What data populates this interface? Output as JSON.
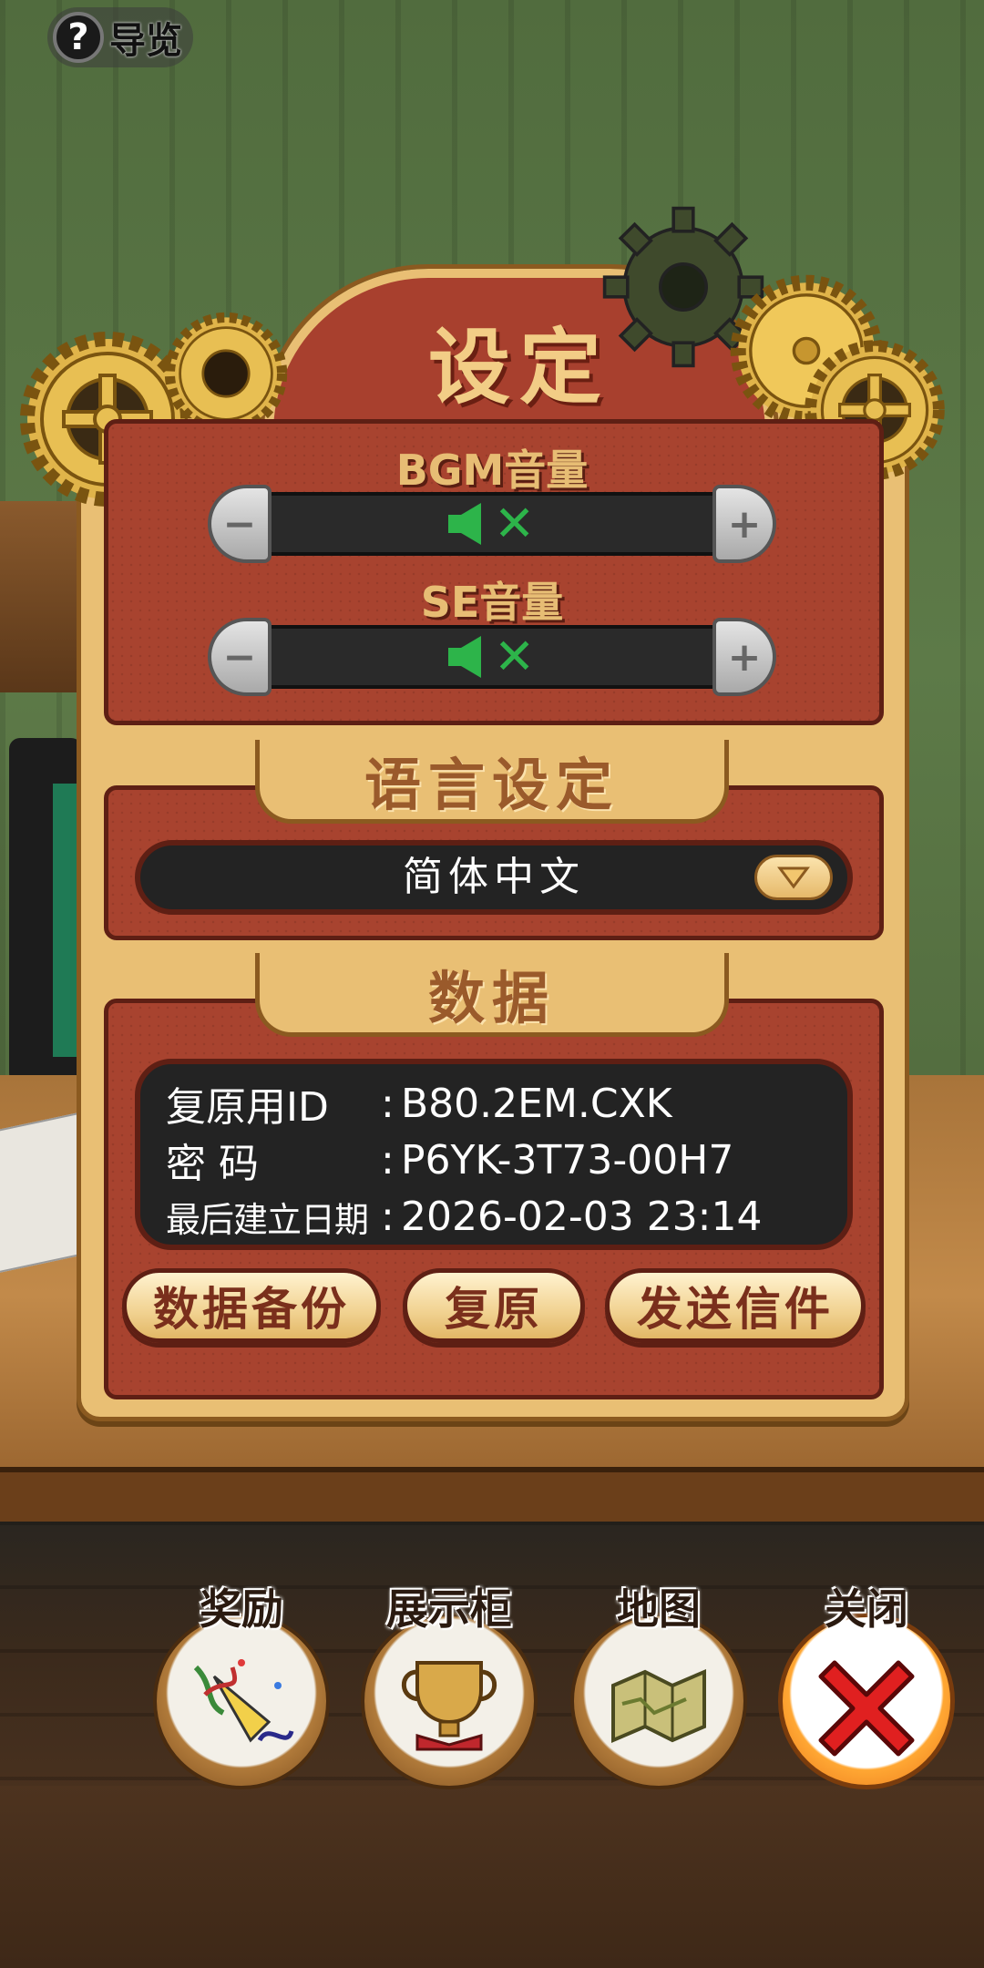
{
  "guide": {
    "icon": "question-icon",
    "glyph": "?",
    "label": "导览"
  },
  "settings": {
    "title": "设定",
    "sound": {
      "bgm_label": "BGM音量",
      "se_label": "SE音量",
      "bgm_state": "muted",
      "se_state": "muted",
      "minus_glyph": "−",
      "plus_glyph": "+"
    },
    "language": {
      "header": "语言设定",
      "selected": "简体中文"
    },
    "data": {
      "header": "数据",
      "rows": [
        {
          "key": "复原用ID",
          "colon": ":",
          "value": "B80.2EM.CXK"
        },
        {
          "key": "密 码",
          "colon": ":",
          "value": "P6YK-3T73-00H7"
        },
        {
          "key": "最后建立日期",
          "colon": ":",
          "value": "2026-02-03 23:14"
        }
      ],
      "buttons": {
        "backup": "数据备份",
        "restore": "复原",
        "send_mail": "发送信件"
      }
    }
  },
  "nav": {
    "rewards": "奖励",
    "showcase": "展示柜",
    "map": "地图",
    "close": "关闭"
  },
  "colors": {
    "panel": "#e9bf74",
    "panel_red": "#a8432f",
    "title_text": "#f2cd86",
    "mute_green": "#2db44a",
    "close_red": "#e02020"
  }
}
